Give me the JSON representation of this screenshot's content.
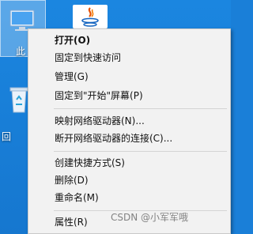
{
  "desktop": {
    "pc_label": "此",
    "bin_label": "回",
    "colors": {
      "background": "#1a7fd8",
      "menu_bg": "#f2f2f2",
      "separator": "#d4d4d4"
    }
  },
  "menu": {
    "items": [
      {
        "label": "打开(O)",
        "bold": true
      },
      {
        "label": "固定到快速访问"
      },
      {
        "label": "管理(G)"
      },
      {
        "label": "固定到\"开始\"屏幕(P)"
      },
      {
        "label": "映射网络驱动器(N)..."
      },
      {
        "label": "断开网络驱动器的连接(C)..."
      },
      {
        "label": "创建快捷方式(S)"
      },
      {
        "label": "删除(D)"
      },
      {
        "label": "重命名(M)"
      },
      {
        "label": "属性(R)"
      }
    ]
  },
  "watermark": "CSDN @小军军哦"
}
